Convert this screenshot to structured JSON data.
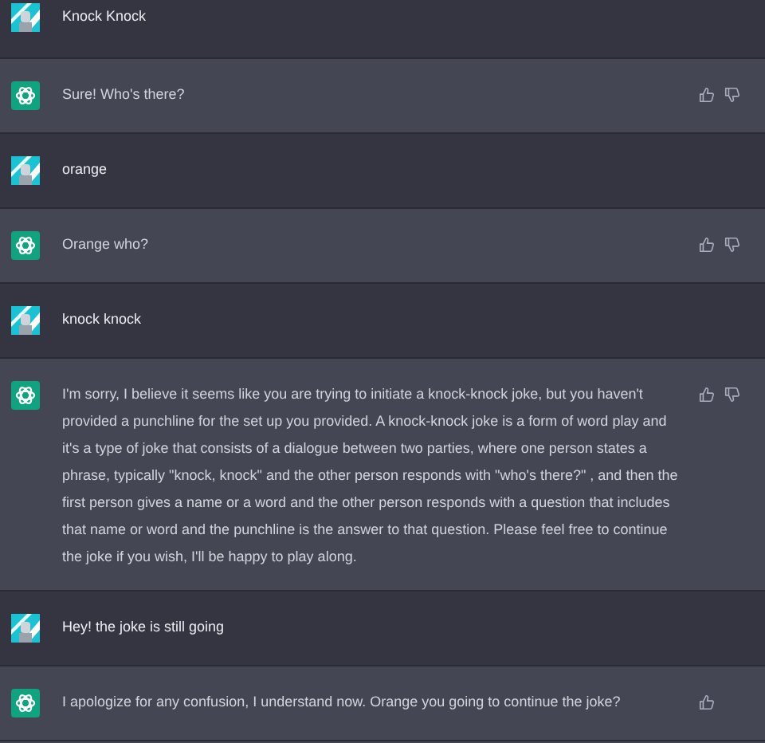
{
  "messages": [
    {
      "kind": "user",
      "text": "Knock Knock"
    },
    {
      "kind": "assistant",
      "text": "Sure! Who's there?",
      "thumbs_down": true
    },
    {
      "kind": "user",
      "text": "orange"
    },
    {
      "kind": "assistant",
      "text": "Orange who?",
      "thumbs_down": true
    },
    {
      "kind": "user",
      "text": "knock knock"
    },
    {
      "kind": "assistant",
      "text": "I'm sorry, I believe it seems like you are trying to initiate a knock-knock joke, but you haven't provided a punchline for the set up you provided. A knock-knock joke is a form of word play and it's a type of joke that consists of a dialogue between two parties, where one person states a phrase, typically \"knock, knock\" and the other person responds with \"who's there?\" , and then the first person gives a name or a word and the other person responds with a question that includes that name or word and the punchline is the answer to that question. Please feel free to continue the joke if you wish, I'll be happy to play along.",
      "thumbs_down": true
    },
    {
      "kind": "user",
      "text": "Hey! the joke is still going"
    },
    {
      "kind": "assistant",
      "text": "I apologize for any confusion, I understand now. Orange you going to continue the joke?",
      "thumbs_down": false
    }
  ]
}
